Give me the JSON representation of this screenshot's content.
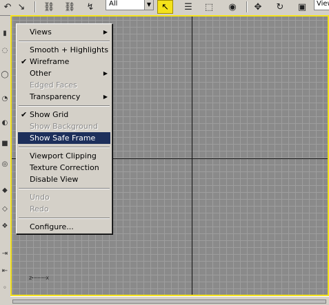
{
  "toolbar": {
    "filter_value": "All",
    "viewport_dropdown_value": "View",
    "icons": [
      "link-icon",
      "unlink-icon",
      "bind-spacewarp-icon",
      "select-object-icon",
      "select-by-name-icon",
      "rectangular-selection-icon",
      "window-crossing-icon",
      "move-icon",
      "rotate-icon",
      "scale-icon"
    ]
  },
  "context_menu": {
    "items": [
      {
        "label": "Views",
        "submenu": true
      },
      {
        "label": "Smooth + Highlights"
      },
      {
        "label": "Wireframe",
        "checked": true
      },
      {
        "label": "Other",
        "submenu": true
      },
      {
        "label": "Edged Faces",
        "disabled": true
      },
      {
        "label": "Transparency",
        "submenu": true
      },
      {
        "label": "Show Grid",
        "checked": true
      },
      {
        "label": "Show Background",
        "disabled": true
      },
      {
        "label": "Show Safe Frame",
        "highlighted": true
      },
      {
        "label": "Viewport Clipping"
      },
      {
        "label": "Texture Correction"
      },
      {
        "label": "Disable View"
      },
      {
        "label": "Undo",
        "disabled": true
      },
      {
        "label": "Redo",
        "disabled": true
      },
      {
        "label": "Configure..."
      }
    ]
  },
  "viewport": {
    "axis_tripod_label": "z",
    "axis_tripod_label_x": "x"
  },
  "colors": {
    "active_border": "#f4e21a",
    "highlight": "#1d2f5b",
    "grid": "#8a8a8a"
  }
}
